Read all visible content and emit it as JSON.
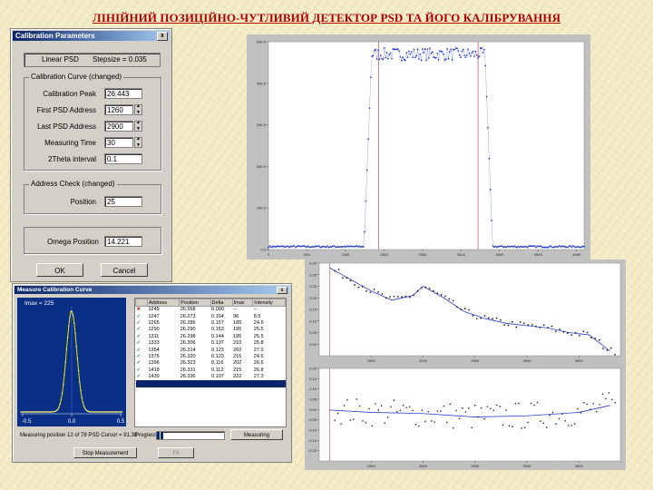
{
  "page_title": "ЛІНІЙНИЙ ПОЗИЦІЙНО-ЧУТЛИВИЙ ДЕТЕКТОР PSD ТА ЙОГО КАЛІБРУВАННЯ",
  "calibration_dialog": {
    "title": "Calibration Parameters",
    "close_glyph": "x",
    "psd_type": "Linear PSD",
    "stepsize": "Stepsize = 0.035",
    "curve_group": "Calibration Curve (changed)",
    "fields": [
      {
        "label": "Calibration Peak",
        "value": "26.443"
      },
      {
        "label": "First PSD Address",
        "value": "1260"
      },
      {
        "label": "Last PSD Address",
        "value": "2900"
      },
      {
        "label": "Measuring Time",
        "value": "30"
      },
      {
        "label": "2Theta interval",
        "value": "0.1"
      }
    ],
    "address_group": "Address Check (changed)",
    "position_label": "Position",
    "position_value": "25",
    "omega_label": "Omega Position",
    "omega_value": "14.221",
    "ok_label": "OK",
    "cancel_label": "Cancel"
  },
  "measure_window": {
    "title": "Measure Calibration Curve",
    "imax": "Imax = 225",
    "axis_ticks": [
      "-0.5",
      "0.0",
      "0.5"
    ],
    "columns": [
      "Address",
      "Position",
      "Delta",
      "Imax",
      "Intensity"
    ],
    "rows": [
      {
        "status": "✕",
        "ok": false,
        "address": "1245",
        "position": "26.568",
        "delta": "0.000",
        "imax": "--",
        "intensity": "--"
      },
      {
        "status": "✓",
        "ok": true,
        "address": "1247",
        "position": "26.273",
        "delta": "0.164",
        "imax": "96",
        "intensity": "8.5"
      },
      {
        "status": "✓",
        "ok": true,
        "address": "1265",
        "position": "26.286",
        "delta": "0.157",
        "imax": "185",
        "intensity": "24.9"
      },
      {
        "status": "✓",
        "ok": true,
        "address": "1290",
        "position": "26.290",
        "delta": "0.153",
        "imax": "195",
        "intensity": "25.5"
      },
      {
        "status": "✓",
        "ok": true,
        "address": "1311",
        "position": "26.298",
        "delta": "0.144",
        "imax": "195",
        "intensity": "25.5"
      },
      {
        "status": "✓",
        "ok": true,
        "address": "1333",
        "position": "26.306",
        "delta": "0.137",
        "imax": "210",
        "intensity": "25.8"
      },
      {
        "status": "✓",
        "ok": true,
        "address": "1354",
        "position": "26.314",
        "delta": "0.123",
        "imax": "202",
        "intensity": "27.0"
      },
      {
        "status": "✓",
        "ok": true,
        "address": "1375",
        "position": "26.320",
        "delta": "0.123",
        "imax": "215",
        "intensity": "24.6"
      },
      {
        "status": "✓",
        "ok": true,
        "address": "1396",
        "position": "26.323",
        "delta": "0.116",
        "imax": "202",
        "intensity": "26.6"
      },
      {
        "status": "✓",
        "ok": true,
        "address": "1418",
        "position": "26.331",
        "delta": "0.112",
        "imax": "215",
        "intensity": "26.8"
      },
      {
        "status": "✓",
        "ok": true,
        "address": "1439",
        "position": "26.336",
        "delta": "0.107",
        "imax": "222",
        "intensity": "27.3"
      }
    ],
    "measuring_text": "Measuring position 12 of 78   PSD Cursor = 91.38",
    "progress_label": "Progress",
    "progress_fraction": 0.09,
    "measuring_button": "Measuring",
    "stop_button": "Stop Measurement",
    "fit_button": "Fit"
  },
  "chart_data": [
    {
      "type": "scatter",
      "description_role": "PSD address response",
      "x_ticks": [
        "0",
        "500",
        "1000",
        "1500",
        "2000",
        "2500",
        "3000",
        "3500",
        "4000"
      ],
      "y_ticks": [
        "0.0",
        "100.0",
        "200.0",
        "300.0",
        "400.0",
        "500.0"
      ],
      "xlim": [
        0,
        4096
      ],
      "ylim": [
        0,
        500
      ],
      "plateau_start": 1300,
      "plateau_end": 2850,
      "plateau_level": 470,
      "edges_marked": [
        1430,
        2720
      ],
      "low_level": 5
    },
    {
      "type": "line",
      "description_role": "calibration curve",
      "x_ticks": [
        "1500",
        "2000",
        "2500",
        "3000",
        "3500"
      ],
      "y_ticks": [
        "0.35",
        "0.30",
        "0.25",
        "0.20",
        "0.15",
        "0.10",
        "0.05",
        "0.00"
      ],
      "xlim": [
        1000,
        3900
      ],
      "ylim": [
        0.0,
        0.4
      ],
      "fit_x": [
        1100,
        1300,
        1500,
        1700,
        1900,
        2000,
        2200,
        2400,
        2600,
        2800,
        3000,
        3200,
        3400,
        3600,
        3800
      ],
      "fit_y": [
        0.38,
        0.33,
        0.28,
        0.24,
        0.26,
        0.3,
        0.25,
        0.19,
        0.16,
        0.14,
        0.13,
        0.12,
        0.1,
        0.09,
        0.02
      ]
    },
    {
      "type": "scatter",
      "description_role": "residuals",
      "x_ticks": [
        "1500",
        "2000",
        "2500",
        "3000",
        "3500"
      ],
      "y_ticks": [
        "0.20",
        "0.15",
        "0.10",
        "0.05",
        "0.00",
        "-0.05",
        "-0.10",
        "-0.15",
        "-0.20"
      ],
      "xlim": [
        1000,
        3900
      ],
      "ylim": [
        -0.2,
        0.2
      ],
      "fit_x": [
        1100,
        1500,
        2000,
        2500,
        3000,
        3500,
        3800
      ],
      "fit_y": [
        0.02,
        0.01,
        0.005,
        -0.01,
        -0.005,
        0.01,
        0.04
      ]
    }
  ],
  "colors": {
    "title_red": "#b00000",
    "page_bg": "#f2ebc4",
    "plot_blue": "#2a3fd0",
    "gauss_yellow": "#e6e600",
    "marker_red": "#b03030"
  }
}
